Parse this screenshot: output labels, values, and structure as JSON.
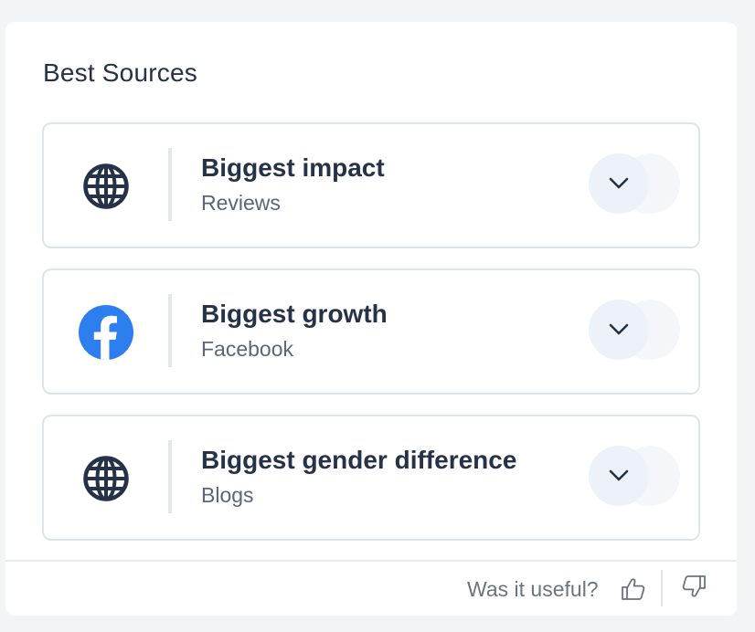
{
  "panel": {
    "title": "Best Sources"
  },
  "cards": [
    {
      "title": "Biggest impact",
      "subtitle": "Reviews",
      "icon": "globe-icon"
    },
    {
      "title": "Biggest growth",
      "subtitle": "Facebook",
      "icon": "facebook-icon"
    },
    {
      "title": "Biggest gender difference",
      "subtitle": "Blogs",
      "icon": "globe-icon"
    }
  ],
  "footer": {
    "question": "Was it useful?"
  },
  "colors": {
    "text_dark": "#253248",
    "text_muted": "#5b6577",
    "facebook_blue": "#2d7ff0",
    "button_bg": "#edf1fa",
    "border": "#dfe3ea"
  }
}
